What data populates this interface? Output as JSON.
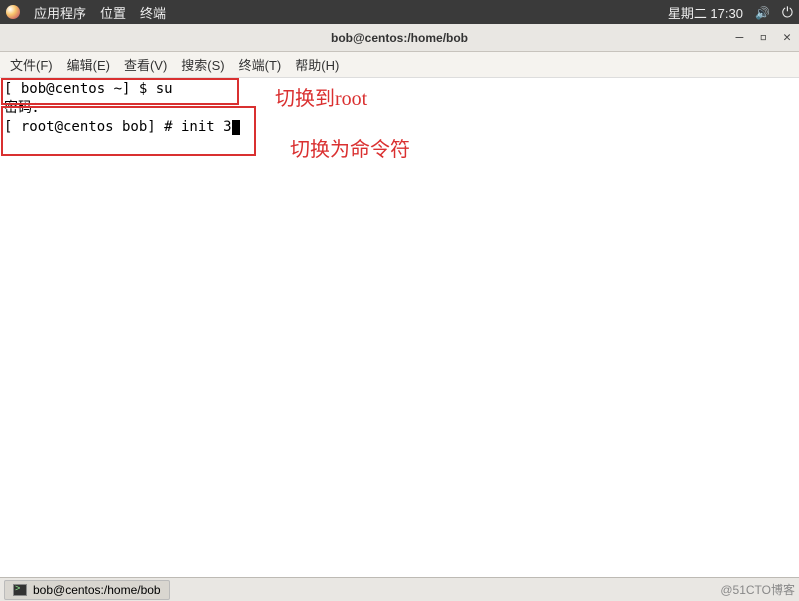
{
  "panel": {
    "menus": [
      "应用程序",
      "位置",
      "终端"
    ],
    "clock": "星期二 17:30"
  },
  "window": {
    "title": "bob@centos:/home/bob",
    "controls": {
      "min": "—",
      "max": "▫",
      "close": "✕"
    }
  },
  "menubar": {
    "file": "文件(F)",
    "edit": "编辑(E)",
    "view": "查看(V)",
    "search": "搜索(S)",
    "terminal": "终端(T)",
    "help": "帮助(H)"
  },
  "terminal": {
    "line1": "[ bob@centos ~] $ su",
    "line2": "密码：",
    "line3": "[ root@centos bob] # init 3"
  },
  "annotations": {
    "switch_root": "切换到root",
    "switch_cmd": "切换为命令符"
  },
  "taskbar": {
    "task_label": "bob@centos:/home/bob",
    "watermark": "@51CTO博客"
  }
}
